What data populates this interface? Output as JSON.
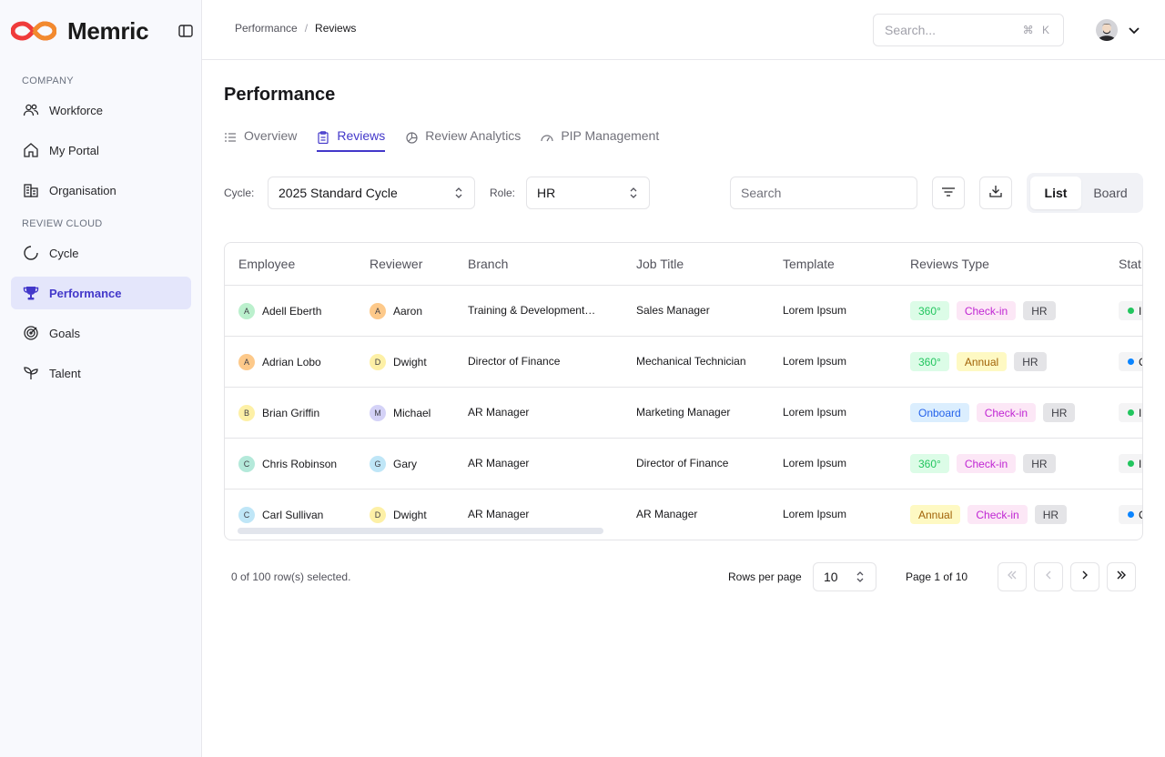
{
  "app": {
    "name": "Memric"
  },
  "colors": {
    "accent": "#4338ca",
    "active_nav_bg": "#e4e6fb",
    "logo_red": "#ef3b3b",
    "logo_orange": "#f28a2e"
  },
  "sidebar": {
    "sections": [
      {
        "label": "COMPANY",
        "items": [
          {
            "label": "Workforce",
            "icon": "users-icon"
          },
          {
            "label": "My Portal",
            "icon": "home-icon"
          },
          {
            "label": "Organisation",
            "icon": "building-icon"
          }
        ]
      },
      {
        "label": "REVIEW CLOUD",
        "items": [
          {
            "label": "Cycle",
            "icon": "cycle-icon"
          },
          {
            "label": "Performance",
            "icon": "trophy-icon",
            "active": true
          },
          {
            "label": "Goals",
            "icon": "target-icon"
          },
          {
            "label": "Talent",
            "icon": "sprout-icon"
          }
        ]
      }
    ]
  },
  "topbar": {
    "breadcrumb": [
      "Performance",
      "Reviews"
    ],
    "search_placeholder": "Search...",
    "search_shortcut": "⌘ K"
  },
  "page": {
    "title": "Performance",
    "tabs": [
      {
        "label": "Overview",
        "icon": "list-icon"
      },
      {
        "label": "Reviews",
        "icon": "clipboard-icon",
        "active": true
      },
      {
        "label": "Review Analytics",
        "icon": "pie-chart-icon"
      },
      {
        "label": "PIP Management",
        "icon": "gauge-icon"
      }
    ]
  },
  "filters": {
    "cycle_label": "Cycle:",
    "cycle_value": "2025 Standard Cycle",
    "role_label": "Role:",
    "role_value": "HR",
    "search_placeholder": "Search",
    "views": [
      "List",
      "Board"
    ],
    "active_view": "List"
  },
  "table": {
    "columns": [
      "Employee",
      "Reviewer",
      "Branch",
      "Job Title",
      "Template",
      "Reviews Type",
      "Stat"
    ],
    "rows": [
      {
        "employee": "Adell Eberth",
        "employee_initial": "A",
        "employee_color": "#bbf0cd",
        "reviewer": "Aaron",
        "reviewer_initial": "A",
        "reviewer_color": "#fdc98a",
        "branch": "Training & Development…",
        "job_title": "Sales Manager",
        "template": "Lorem Ipsum",
        "types": [
          {
            "label": "360°",
            "kind": "green"
          },
          {
            "label": "Check-in",
            "kind": "pink"
          },
          {
            "label": "HR",
            "kind": "gray"
          }
        ],
        "status_text": "I",
        "status_color": "#22c55e"
      },
      {
        "employee": "Adrian Lobo",
        "employee_initial": "A",
        "employee_color": "#fdc98a",
        "reviewer": "Dwight",
        "reviewer_initial": "D",
        "reviewer_color": "#fdf0a6",
        "branch": "Director of Finance",
        "job_title": "Mechanical Technician",
        "template": "Lorem Ipsum",
        "types": [
          {
            "label": "360°",
            "kind": "green"
          },
          {
            "label": "Annual",
            "kind": "yellow"
          },
          {
            "label": "HR",
            "kind": "gray"
          }
        ],
        "status_text": "C",
        "status_color": "#0a84ff"
      },
      {
        "employee": "Brian Griffin",
        "employee_initial": "B",
        "employee_color": "#fdf0a6",
        "reviewer": "Michael",
        "reviewer_initial": "M",
        "reviewer_color": "#d4d2f7",
        "branch": "AR Manager",
        "job_title": "Marketing Manager",
        "template": "Lorem Ipsum",
        "types": [
          {
            "label": "Onboard",
            "kind": "blue"
          },
          {
            "label": "Check-in",
            "kind": "pink"
          },
          {
            "label": "HR",
            "kind": "gray"
          }
        ],
        "status_text": "I",
        "status_color": "#22c55e"
      },
      {
        "employee": "Chris Robinson",
        "employee_initial": "C",
        "employee_color": "#b4e9da",
        "reviewer": "Gary",
        "reviewer_initial": "G",
        "reviewer_color": "#bfe6f7",
        "branch": "AR Manager",
        "job_title": "Director of Finance",
        "template": "Lorem Ipsum",
        "types": [
          {
            "label": "360°",
            "kind": "green"
          },
          {
            "label": "Check-in",
            "kind": "pink"
          },
          {
            "label": "HR",
            "kind": "gray"
          }
        ],
        "status_text": "I",
        "status_color": "#22c55e"
      },
      {
        "employee": "Carl Sullivan",
        "employee_initial": "C",
        "employee_color": "#bfe6f7",
        "reviewer": "Dwight",
        "reviewer_initial": "D",
        "reviewer_color": "#fdf0a6",
        "branch": "AR Manager",
        "job_title": "AR Manager",
        "template": "Lorem Ipsum",
        "types": [
          {
            "label": "Annual",
            "kind": "yellow"
          },
          {
            "label": "Check-in",
            "kind": "pink"
          },
          {
            "label": "HR",
            "kind": "gray"
          }
        ],
        "status_text": "C",
        "status_color": "#0a84ff"
      }
    ]
  },
  "badge_styles": {
    "green": {
      "bg": "#dcfce7",
      "fg": "#22c55e"
    },
    "pink": {
      "bg": "#fce7f6",
      "fg": "#c026d3"
    },
    "gray": {
      "bg": "#e4e4e7",
      "fg": "#3f3f46"
    },
    "yellow": {
      "bg": "#fef9c3",
      "fg": "#a16207"
    },
    "blue": {
      "bg": "#dbeefe",
      "fg": "#2563eb"
    }
  },
  "footer": {
    "selected_text": "0 of 100 row(s) selected.",
    "rows_per_page_label": "Rows per page",
    "rows_per_page_value": "10",
    "page_info": "Page 1 of 10"
  }
}
